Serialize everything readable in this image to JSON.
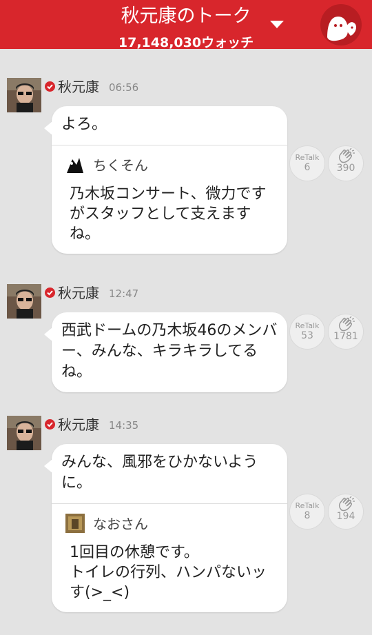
{
  "header": {
    "title": "秋元康のトーク",
    "watch_count": "17,148,030ウォッチ"
  },
  "posts": [
    {
      "author": "秋元康",
      "time": "06:56",
      "text": "よろ。",
      "quote": {
        "name": "ちくそん",
        "text": "乃木坂コンサート、微力ですがスタッフとして支えますね。"
      },
      "retalk_label": "ReTalk",
      "retalk_count": "6",
      "clap_count": "390"
    },
    {
      "author": "秋元康",
      "time": "12:47",
      "text": "西武ドームの乃木坂46のメンバー、みんな、キラキラしてるね。",
      "retalk_label": "ReTalk",
      "retalk_count": "53",
      "clap_count": "1781"
    },
    {
      "author": "秋元康",
      "time": "14:35",
      "text": "みんな、風邪をひかないように。",
      "quote": {
        "name": "なおさん",
        "text": "1回目の休憩です。\nトイレの行列、ハンパないッす(>_<)"
      },
      "retalk_label": "ReTalk",
      "retalk_count": "8",
      "clap_count": "194"
    }
  ],
  "colors": {
    "brand_red": "#d8262c",
    "background": "#e3e3e3"
  },
  "icons": [
    "dropdown-caret-icon",
    "mascot-icon",
    "verified-icon",
    "clap-icon"
  ]
}
